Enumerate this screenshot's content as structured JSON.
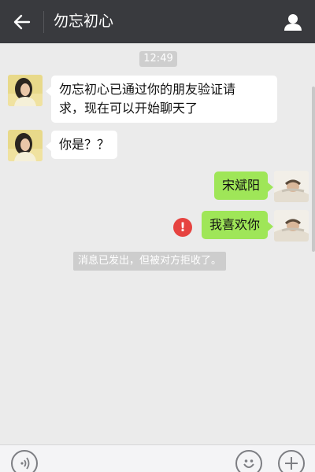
{
  "header": {
    "title": "勿忘初心"
  },
  "messages": {
    "time": "12:49",
    "incoming_1": [
      "勿忘初心已通过你的朋友验证请",
      "求，现在可以开始聊天了"
    ],
    "incoming_2": "你是？？",
    "outgoing_1": "宋斌阳",
    "outgoing_2": "我喜欢你",
    "error_mark": "!",
    "system_notice": "消息已发出，但被对方拒收了。"
  },
  "colors": {
    "header_bg": "#393a3e",
    "outgoing_bubble": "#9fe658",
    "error": "#e64340"
  },
  "icons": {
    "back": "back-arrow-icon",
    "profile": "person-icon",
    "voice": "voice-icon",
    "emoji": "emoji-icon",
    "add": "plus-icon"
  }
}
